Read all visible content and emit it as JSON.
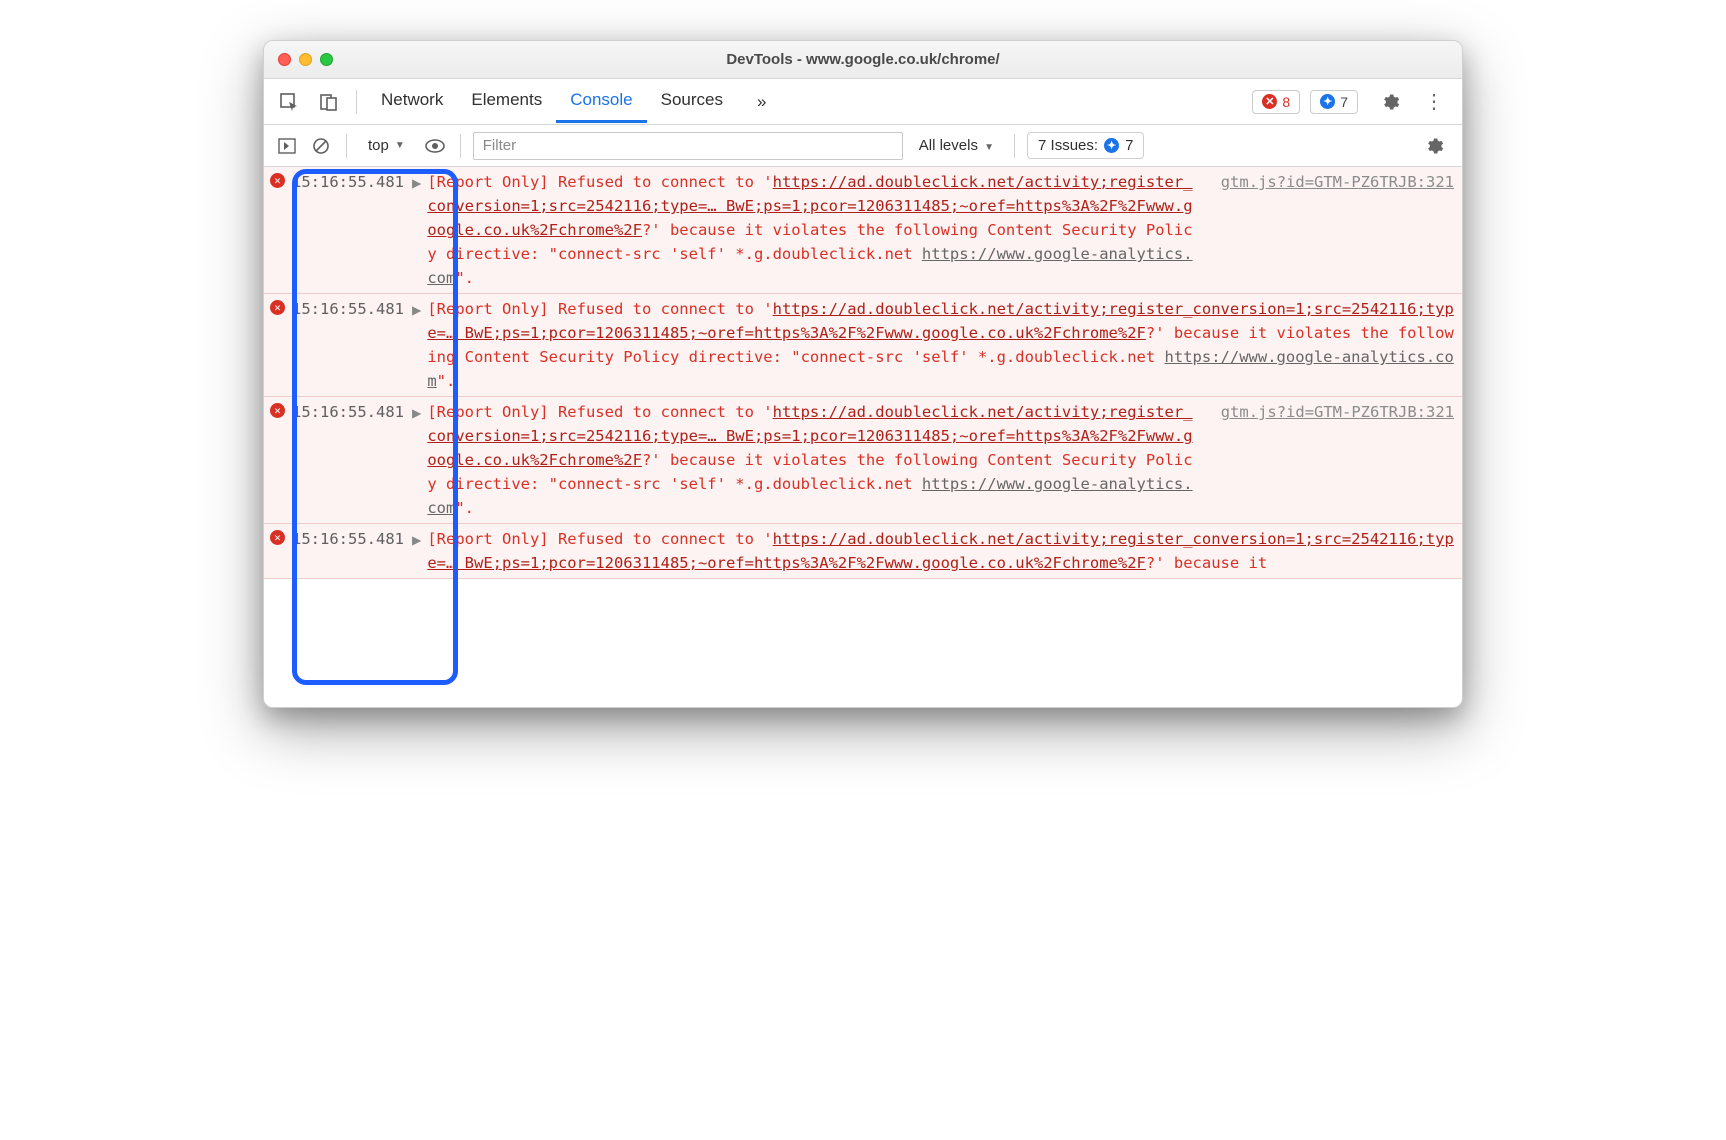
{
  "window": {
    "title": "DevTools - www.google.co.uk/chrome/"
  },
  "tabs": {
    "items": [
      "Network",
      "Elements",
      "Console",
      "Sources"
    ],
    "more": "»",
    "active": "Console"
  },
  "badges": {
    "errors": "8",
    "messages": "7"
  },
  "toolbar2": {
    "context": "top",
    "filter_placeholder": "Filter",
    "levels": "All levels",
    "issues_label": "7 Issues:",
    "issues_count": "7"
  },
  "annotation": {
    "highlight": "timestamp-column"
  },
  "logs": [
    {
      "timestamp": "15:16:55.481",
      "prefix": "[Report Only] Refused to connect to '",
      "url": "https://ad.doubleclick.net/activity;register_conversion=1;src=2542116;type=… BwE;ps=1;pcor=1206311485;~oref=https%3A%2F%2Fwww.google.co.uk%2Fchrome%2F",
      "mid": "?' because it violates the following Content Security Policy directive: \"connect-src 'self' *.g.doubleclick.net ",
      "url2": "https://www.google-analytics.com",
      "suffix": "\".",
      "source": "gtm.js?id=GTM-PZ6TRJB:321"
    },
    {
      "timestamp": "15:16:55.481",
      "prefix": "[Report Only] Refused to connect to '",
      "url": "https://ad.doubleclick.net/activity;register_conversion=1;src=2542116;type=… BwE;ps=1;pcor=1206311485;~oref=https%3A%2F%2Fwww.google.co.uk%2Fchrome%2F",
      "mid": "?' because it violates the following Content Security Policy directive: \"connect-src 'self' *.g.doubleclick.net ",
      "url2": "https://www.google-analytics.com",
      "suffix": "\".",
      "source": ""
    },
    {
      "timestamp": "15:16:55.481",
      "prefix": "[Report Only] Refused to connect to '",
      "url": "https://ad.doubleclick.net/activity;register_conversion=1;src=2542116;type=… BwE;ps=1;pcor=1206311485;~oref=https%3A%2F%2Fwww.google.co.uk%2Fchrome%2F",
      "mid": "?' because it violates the following Content Security Policy directive: \"connect-src 'self' *.g.doubleclick.net ",
      "url2": "https://www.google-analytics.com",
      "suffix": "\".",
      "source": "gtm.js?id=GTM-PZ6TRJB:321"
    },
    {
      "timestamp": "15:16:55.481",
      "prefix": "[Report Only] Refused to connect to '",
      "url": "https://ad.doubleclick.net/activity;register_conversion=1;src=2542116;type=… BwE;ps=1;pcor=1206311485;~oref=https%3A%2F%2Fwww.google.co.uk%2Fchrome%2F",
      "mid": "?' because it",
      "url2": "",
      "suffix": "",
      "source": ""
    }
  ]
}
